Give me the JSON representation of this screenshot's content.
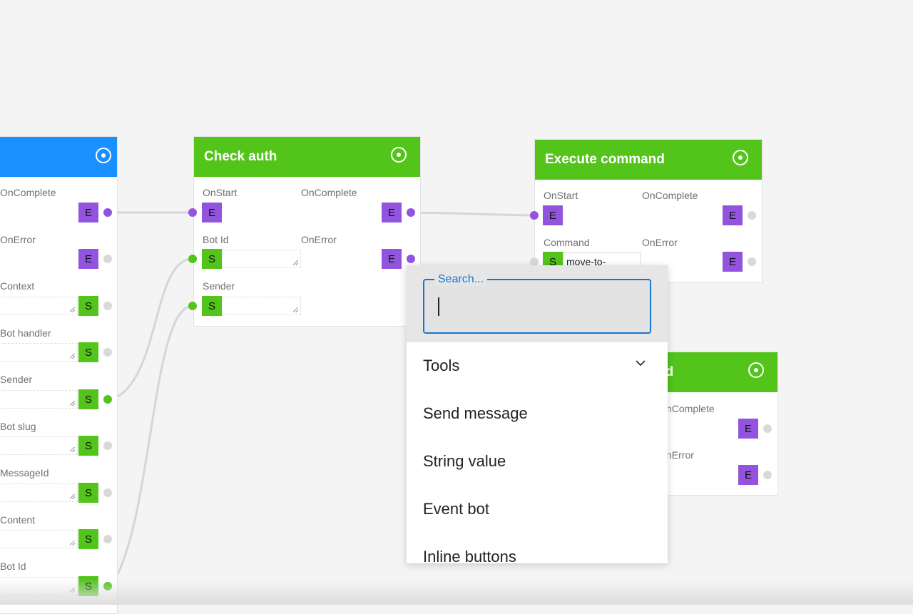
{
  "nodes": {
    "left_node": {
      "labels": [
        "OnComplete",
        "OnError",
        "Context",
        "Bot handler",
        "Sender",
        "Bot slug",
        "MessageId",
        "Content",
        "Bot Id"
      ]
    },
    "check_auth": {
      "title": "Check auth",
      "inputs": [
        "OnStart",
        "Bot Id",
        "Sender"
      ],
      "outputs": [
        "OnComplete",
        "OnError"
      ]
    },
    "execute_command": {
      "title": "Execute command",
      "inputs": [
        "OnStart",
        "Command"
      ],
      "outputs": [
        "OnComplete",
        "OnError"
      ],
      "command_value": "move-to-"
    },
    "partial_node": {
      "title_visible": "nd",
      "outputs_visible": [
        "nComplete",
        "nError"
      ]
    }
  },
  "pins": {
    "event": "E",
    "string": "S"
  },
  "popup": {
    "search_placeholder": "Search...",
    "search_value": "",
    "items": [
      "Tools",
      "Send message",
      "String value",
      "Event bot",
      "Inline buttons"
    ]
  },
  "colors": {
    "header_green": "#52c41a",
    "header_blue": "#1890ff",
    "event_pin": "#9254de",
    "string_pin": "#52c41a",
    "search_accent": "#1677d2"
  }
}
